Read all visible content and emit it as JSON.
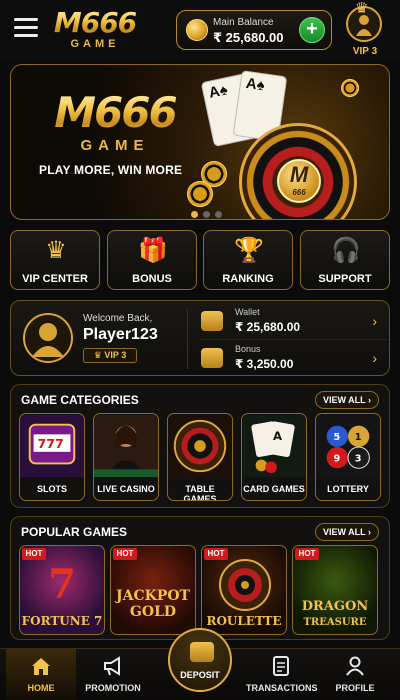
{
  "header": {
    "logo_main": "M666",
    "logo_sub": "GAME",
    "balance_label": "Main Balance",
    "balance_value": "₹ 25,680.00",
    "add_symbol": "+",
    "vip_label": "VIP 3"
  },
  "banner": {
    "brand_main": "M666",
    "brand_sub": "GAME",
    "tagline": "PLAY MORE, WIN MORE",
    "center_logo": "M",
    "center_logo_sub": "666",
    "card_1": "A♠",
    "card_2": "A♠",
    "slide_count": 3,
    "active_slide": 1
  },
  "quick_nav": [
    {
      "label": "VIP CENTER",
      "icon": "crown-icon",
      "glyph": "♛"
    },
    {
      "label": "BONUS",
      "icon": "gift-icon",
      "glyph": "🎁"
    },
    {
      "label": "RANKING",
      "icon": "trophy-icon",
      "glyph": "🏆"
    },
    {
      "label": "SUPPORT",
      "icon": "headset-icon",
      "glyph": "🎧"
    }
  ],
  "profile": {
    "welcome": "Welcome Back,",
    "name": "Player123",
    "vip_badge": "♛ VIP 3",
    "wallet_label": "Wallet",
    "wallet_value": "₹ 25,680.00",
    "bonus_label": "Bonus",
    "bonus_value": "₹ 3,250.00"
  },
  "categories": {
    "title": "GAME CATEGORIES",
    "view_all": "VIEW ALL  ›",
    "items": [
      {
        "label": "SLOTS",
        "icon": "slot-machine-icon"
      },
      {
        "label": "LIVE CASINO",
        "icon": "live-dealer-icon"
      },
      {
        "label": "TABLE GAMES",
        "icon": "roulette-icon"
      },
      {
        "label": "CARD GAMES",
        "icon": "playing-cards-icon"
      },
      {
        "label": "LOTTERY",
        "icon": "lottery-balls-icon"
      }
    ]
  },
  "popular": {
    "title": "POPULAR GAMES",
    "view_all": "VIEW ALL  ›",
    "hot_label": "HOT",
    "games": [
      {
        "title": "FORTUNE 7",
        "title_top": "7",
        "color": "#c8311b"
      },
      {
        "title": "JACKPOT GOLD",
        "title_top": "JACKPOT",
        "title_bottom": "GOLD",
        "color": "#e3a92f"
      },
      {
        "title": "ROULETTE",
        "color": "#e3a92f"
      },
      {
        "title": "DRAGON TREASURE",
        "title_top": "DRAGON",
        "title_bottom": "TREASURE",
        "color": "#e3a92f"
      }
    ]
  },
  "bottom_nav": {
    "items": [
      {
        "label": "HOME",
        "icon": "home-icon",
        "active": true
      },
      {
        "label": "PROMOTION",
        "icon": "megaphone-icon",
        "active": false
      },
      {
        "label": "DEPOSIT",
        "icon": "wallet-icon",
        "active": false
      },
      {
        "label": "TRANSACTIONS",
        "icon": "document-icon",
        "active": false
      },
      {
        "label": "PROFILE",
        "icon": "user-icon",
        "active": false
      }
    ]
  },
  "colors": {
    "gold": "#f2c14e",
    "dark_bg": "#0b0b0b",
    "hot_red": "#d11a1a",
    "add_green": "#2aa83a"
  }
}
